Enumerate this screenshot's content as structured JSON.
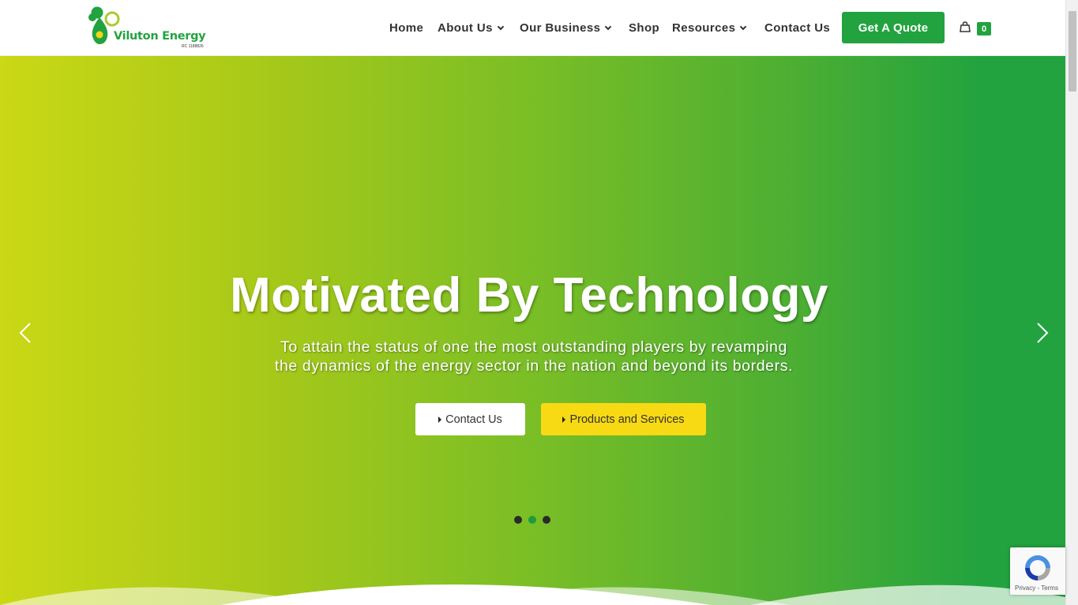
{
  "brand": {
    "name": "Viluton Energy",
    "reg": "RC 1188826",
    "colors": {
      "green": "#22a33f",
      "lime": "#cad815",
      "yellow": "#f7da13"
    }
  },
  "nav": {
    "home": "Home",
    "about": "About Us",
    "business": "Our Business",
    "shop": "Shop",
    "resources": "Resources",
    "contact": "Contact Us",
    "quote_button": "Get A Quote",
    "cart_count": "0"
  },
  "hero": {
    "title": "Motivated By Technology",
    "subtitle_line1": "To attain the status of one the most outstanding players by revamping",
    "subtitle_line2": "the dynamics of the energy sector in the nation and beyond its borders.",
    "btn_contact": "Contact Us",
    "btn_products": "Products and Services",
    "slides_total": 3,
    "active_slide": 2
  },
  "recaptcha": {
    "links": "Privacy - Terms"
  }
}
